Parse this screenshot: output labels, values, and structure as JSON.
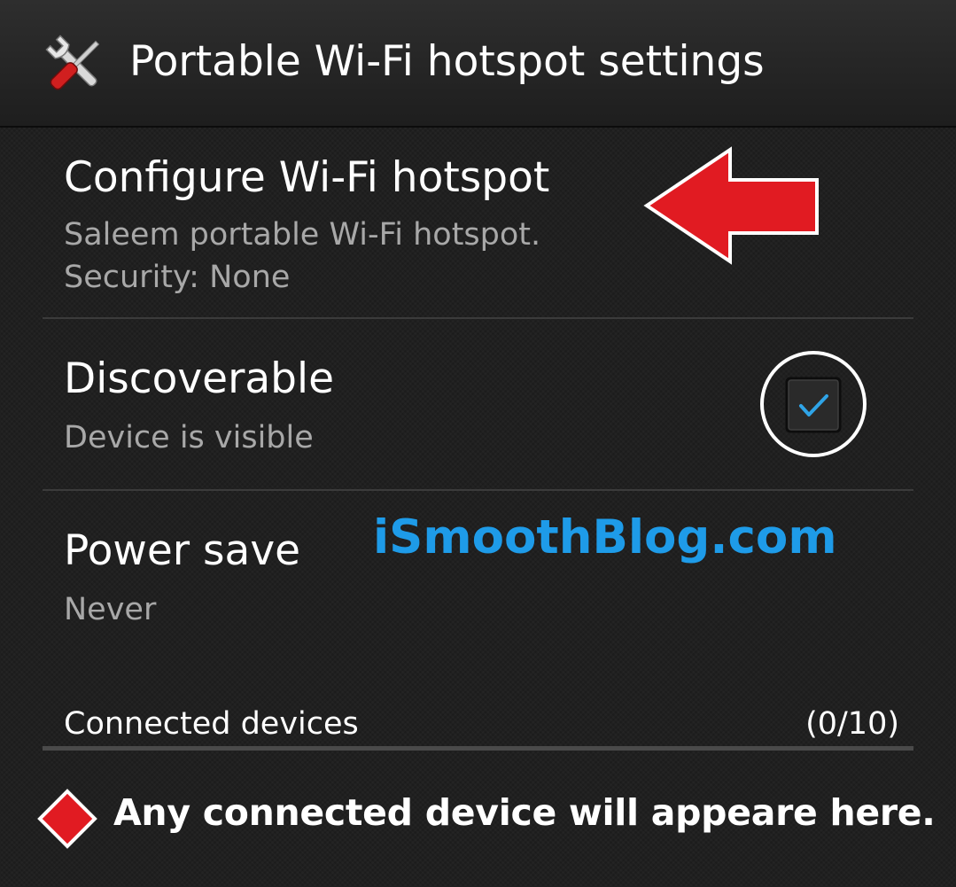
{
  "header": {
    "title": "Portable Wi-Fi hotspot settings",
    "icon": "tools-icon"
  },
  "configure": {
    "title": "Configure Wi-Fi hotspot",
    "subtitle_line1": "Saleem portable Wi-Fi hotspot.",
    "subtitle_line2": "Security: None",
    "annotation": "red-arrow-icon"
  },
  "discoverable": {
    "title": "Discoverable",
    "subtitle": "Device is visible",
    "checked": true,
    "check_color": "#2fa4e7"
  },
  "power_save": {
    "title": "Power save",
    "subtitle": "Never"
  },
  "watermark": "iSmoothBlog.com",
  "connected": {
    "label": "Connected devices",
    "count": "(0/10)"
  },
  "note": {
    "icon": "red-diamond-icon",
    "text": "Any connected device will appeare here."
  },
  "colors": {
    "background": "#1c1c1c",
    "accent_blue": "#1e9be8",
    "arrow_red": "#e11b22"
  }
}
